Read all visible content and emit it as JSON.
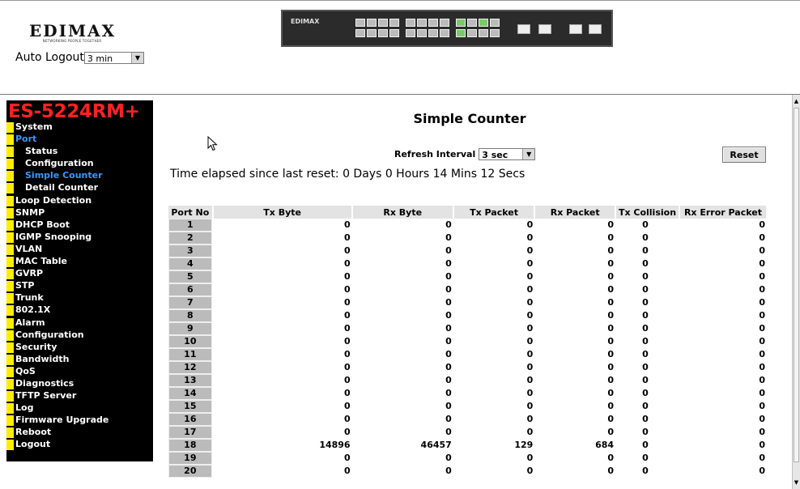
{
  "header": {
    "logo_text": "EDIMAX",
    "logo_tagline": "NETWORKING PEOPLE TOGETHER",
    "auto_logout_label": "Auto Logout",
    "auto_logout_value": "3 min",
    "switch_brand": "EDIMAX"
  },
  "menu": {
    "model": "ES-5224RM+",
    "items": [
      {
        "label": "System"
      },
      {
        "label": "Port"
      },
      {
        "label": "Status"
      },
      {
        "label": "Configuration"
      },
      {
        "label": "Simple Counter"
      },
      {
        "label": "Detail Counter"
      },
      {
        "label": "Loop Detection"
      },
      {
        "label": "SNMP"
      },
      {
        "label": "DHCP Boot"
      },
      {
        "label": "IGMP Snooping"
      },
      {
        "label": "VLAN"
      },
      {
        "label": "MAC Table"
      },
      {
        "label": "GVRP"
      },
      {
        "label": "STP"
      },
      {
        "label": "Trunk"
      },
      {
        "label": "802.1X"
      },
      {
        "label": "Alarm"
      },
      {
        "label": "Configuration"
      },
      {
        "label": "Security"
      },
      {
        "label": "Bandwidth"
      },
      {
        "label": "QoS"
      },
      {
        "label": "Diagnostics"
      },
      {
        "label": "TFTP Server"
      },
      {
        "label": "Log"
      },
      {
        "label": "Firmware Upgrade"
      },
      {
        "label": "Reboot"
      },
      {
        "label": "Logout"
      }
    ]
  },
  "content": {
    "title": "Simple Counter",
    "refresh_label": "Refresh Interval",
    "refresh_value": "3 sec",
    "reset_label": "Reset",
    "elapsed": "Time elapsed since last reset: 0 Days 0 Hours 14 Mins 12 Secs"
  },
  "table": {
    "headers": [
      "Port No",
      "Tx Byte",
      "Rx Byte",
      "Tx Packet",
      "Rx Packet",
      "Tx Collision",
      "Rx Error Packet"
    ],
    "rows": [
      [
        "1",
        "0",
        "0",
        "0",
        "0",
        "0",
        "0"
      ],
      [
        "2",
        "0",
        "0",
        "0",
        "0",
        "0",
        "0"
      ],
      [
        "3",
        "0",
        "0",
        "0",
        "0",
        "0",
        "0"
      ],
      [
        "4",
        "0",
        "0",
        "0",
        "0",
        "0",
        "0"
      ],
      [
        "5",
        "0",
        "0",
        "0",
        "0",
        "0",
        "0"
      ],
      [
        "6",
        "0",
        "0",
        "0",
        "0",
        "0",
        "0"
      ],
      [
        "7",
        "0",
        "0",
        "0",
        "0",
        "0",
        "0"
      ],
      [
        "8",
        "0",
        "0",
        "0",
        "0",
        "0",
        "0"
      ],
      [
        "9",
        "0",
        "0",
        "0",
        "0",
        "0",
        "0"
      ],
      [
        "10",
        "0",
        "0",
        "0",
        "0",
        "0",
        "0"
      ],
      [
        "11",
        "0",
        "0",
        "0",
        "0",
        "0",
        "0"
      ],
      [
        "12",
        "0",
        "0",
        "0",
        "0",
        "0",
        "0"
      ],
      [
        "13",
        "0",
        "0",
        "0",
        "0",
        "0",
        "0"
      ],
      [
        "14",
        "0",
        "0",
        "0",
        "0",
        "0",
        "0"
      ],
      [
        "15",
        "0",
        "0",
        "0",
        "0",
        "0",
        "0"
      ],
      [
        "16",
        "0",
        "0",
        "0",
        "0",
        "0",
        "0"
      ],
      [
        "17",
        "0",
        "0",
        "0",
        "0",
        "0",
        "0"
      ],
      [
        "18",
        "14896",
        "46457",
        "129",
        "684",
        "0",
        "0"
      ],
      [
        "19",
        "0",
        "0",
        "0",
        "0",
        "0",
        "0"
      ],
      [
        "20",
        "0",
        "0",
        "0",
        "0",
        "0",
        "0"
      ]
    ]
  },
  "colors": {
    "menu_bg": "#000000",
    "model_text": "#ff2222",
    "menu_bullet": "#ffee00",
    "active_item": "#3399ff",
    "table_header_bg": "#e3e3e3"
  }
}
